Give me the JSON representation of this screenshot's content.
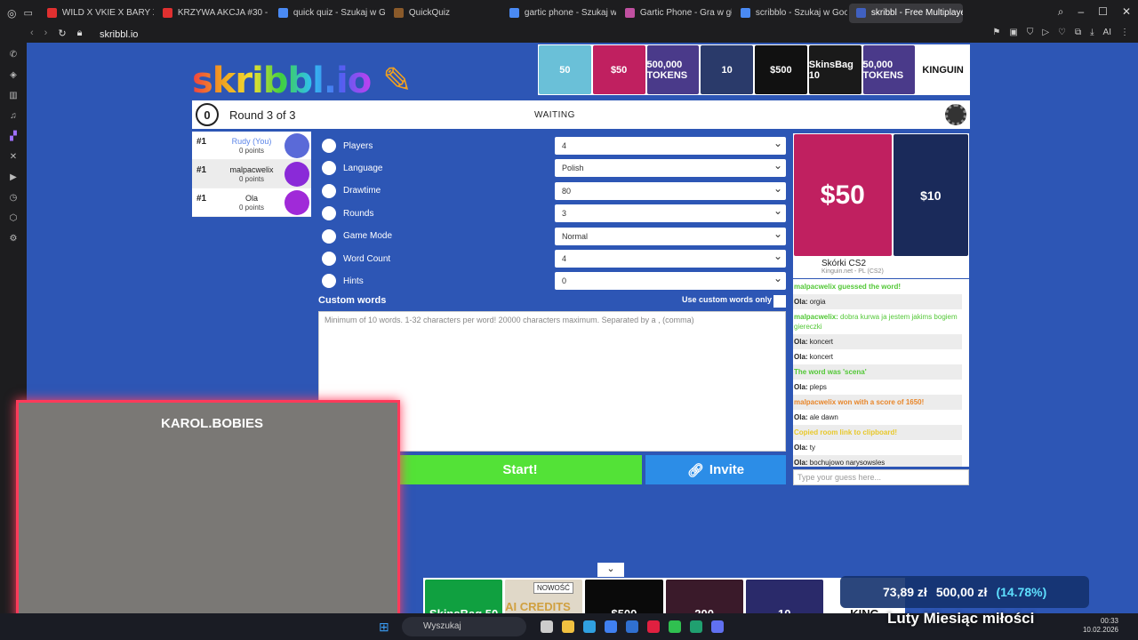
{
  "browser": {
    "tabs": [
      {
        "label": "WILD X VKIE X BARY X KA",
        "color": "#e03030"
      },
      {
        "label": "KRZYWA AKCJA #30 - PR",
        "color": "#e03030"
      },
      {
        "label": "quick quiz - Szukaj w Goo",
        "color": "#4a8af4"
      },
      {
        "label": "QuickQuiz",
        "color": "#8a5a2a"
      },
      {
        "label": "gartic phone - Szukaj w G",
        "color": "#4a8af4"
      },
      {
        "label": "Gartic Phone - Gra w głuc",
        "color": "#c050a0"
      },
      {
        "label": "scribblo - Szukaj w Google",
        "color": "#4a8af4"
      },
      {
        "label": "skribbl - Free Multiplayer",
        "color": "#4060c0"
      }
    ],
    "active_tab": "skribbl - Free Multiplayer",
    "url": "skribbl.io"
  },
  "game": {
    "logo": "skribbl.io",
    "timer": "0",
    "round_label": "Round 3 of 3",
    "status": "WAITING",
    "players": [
      {
        "rank": "#1",
        "name": "Rudy (You)",
        "points": "0 points",
        "avatar_color": "#5a6ad8",
        "is_me": true
      },
      {
        "rank": "#1",
        "name": "malpacwelix",
        "points": "0 points",
        "avatar_color": "#8a2ad8",
        "is_me": false
      },
      {
        "rank": "#1",
        "name": "Ola",
        "points": "0 points",
        "avatar_color": "#a02ad8",
        "is_me": false
      }
    ],
    "settings": [
      {
        "label": "Players",
        "value": "4"
      },
      {
        "label": "Language",
        "value": "Polish"
      },
      {
        "label": "Drawtime",
        "value": "80"
      },
      {
        "label": "Rounds",
        "value": "3"
      },
      {
        "label": "Game Mode",
        "value": "Normal"
      },
      {
        "label": "Word Count",
        "value": "4"
      },
      {
        "label": "Hints",
        "value": "0"
      }
    ],
    "custom_words_label": "Custom words",
    "use_custom_label": "Use custom words only",
    "custom_words_placeholder": "Minimum of 10 words. 1-32 characters per word! 20000 characters maximum. Separated by a , (comma)",
    "start_label": "Start!",
    "invite_label": "Invite"
  },
  "chat": {
    "sponsor_name": "Skórki CS2",
    "sponsor_url": "Kinguin.net - PL (CS2)",
    "messages": [
      {
        "text": "malpacwelix guessed the word!",
        "color": "#53c837",
        "author": ""
      },
      {
        "author": "Ola:",
        "text": "orgia",
        "color": "#222"
      },
      {
        "author": "malpacwelix:",
        "text": "dobra kurwa ja jestem jakims bogiem giereczki",
        "color": "#53c837"
      },
      {
        "author": "Ola:",
        "text": "koncert",
        "color": "#222"
      },
      {
        "author": "Ola:",
        "text": "koncert",
        "color": "#222"
      },
      {
        "text": "The word was 'scena'",
        "color": "#53c837",
        "author": ""
      },
      {
        "author": "Ola:",
        "text": "pleps",
        "color": "#222"
      },
      {
        "text": "malpacwelix won with a score of 1650!",
        "color": "#e8862a",
        "author": ""
      },
      {
        "author": "Ola:",
        "text": "ale dawn",
        "color": "#222"
      },
      {
        "text": "Copied room link to clipboard!",
        "color": "#e8c82a",
        "author": ""
      },
      {
        "author": "Ola:",
        "text": "ty",
        "color": "#222"
      },
      {
        "author": "Ola:",
        "text": "bochujowo narysowsles",
        "color": "#222"
      }
    ],
    "input_placeholder": "Type your guess here..."
  },
  "ads": {
    "top": [
      "50",
      "$50",
      "500,000 TOKENS",
      "10",
      "$500",
      "SkinsBag 10",
      "50,000 TOKENS",
      "KINGUIN"
    ],
    "right": [
      "$50",
      "$10"
    ],
    "bottom": [
      "SkinsBag 50",
      "AI CREDITS 10€",
      "$500",
      "200",
      "10",
      "KING"
    ],
    "bottom_badge": "NOWOŚĆ"
  },
  "stream": {
    "webcam_text": "KAROL.BOBIES",
    "stock_values": [
      "73,89 zł",
      "500,00 zł",
      "(14.78%)"
    ],
    "banner": "Luty Miesiąc miłości"
  },
  "taskbar": {
    "search_label": "Wyszukaj",
    "time": "00:33",
    "date": "10.02.2026"
  }
}
